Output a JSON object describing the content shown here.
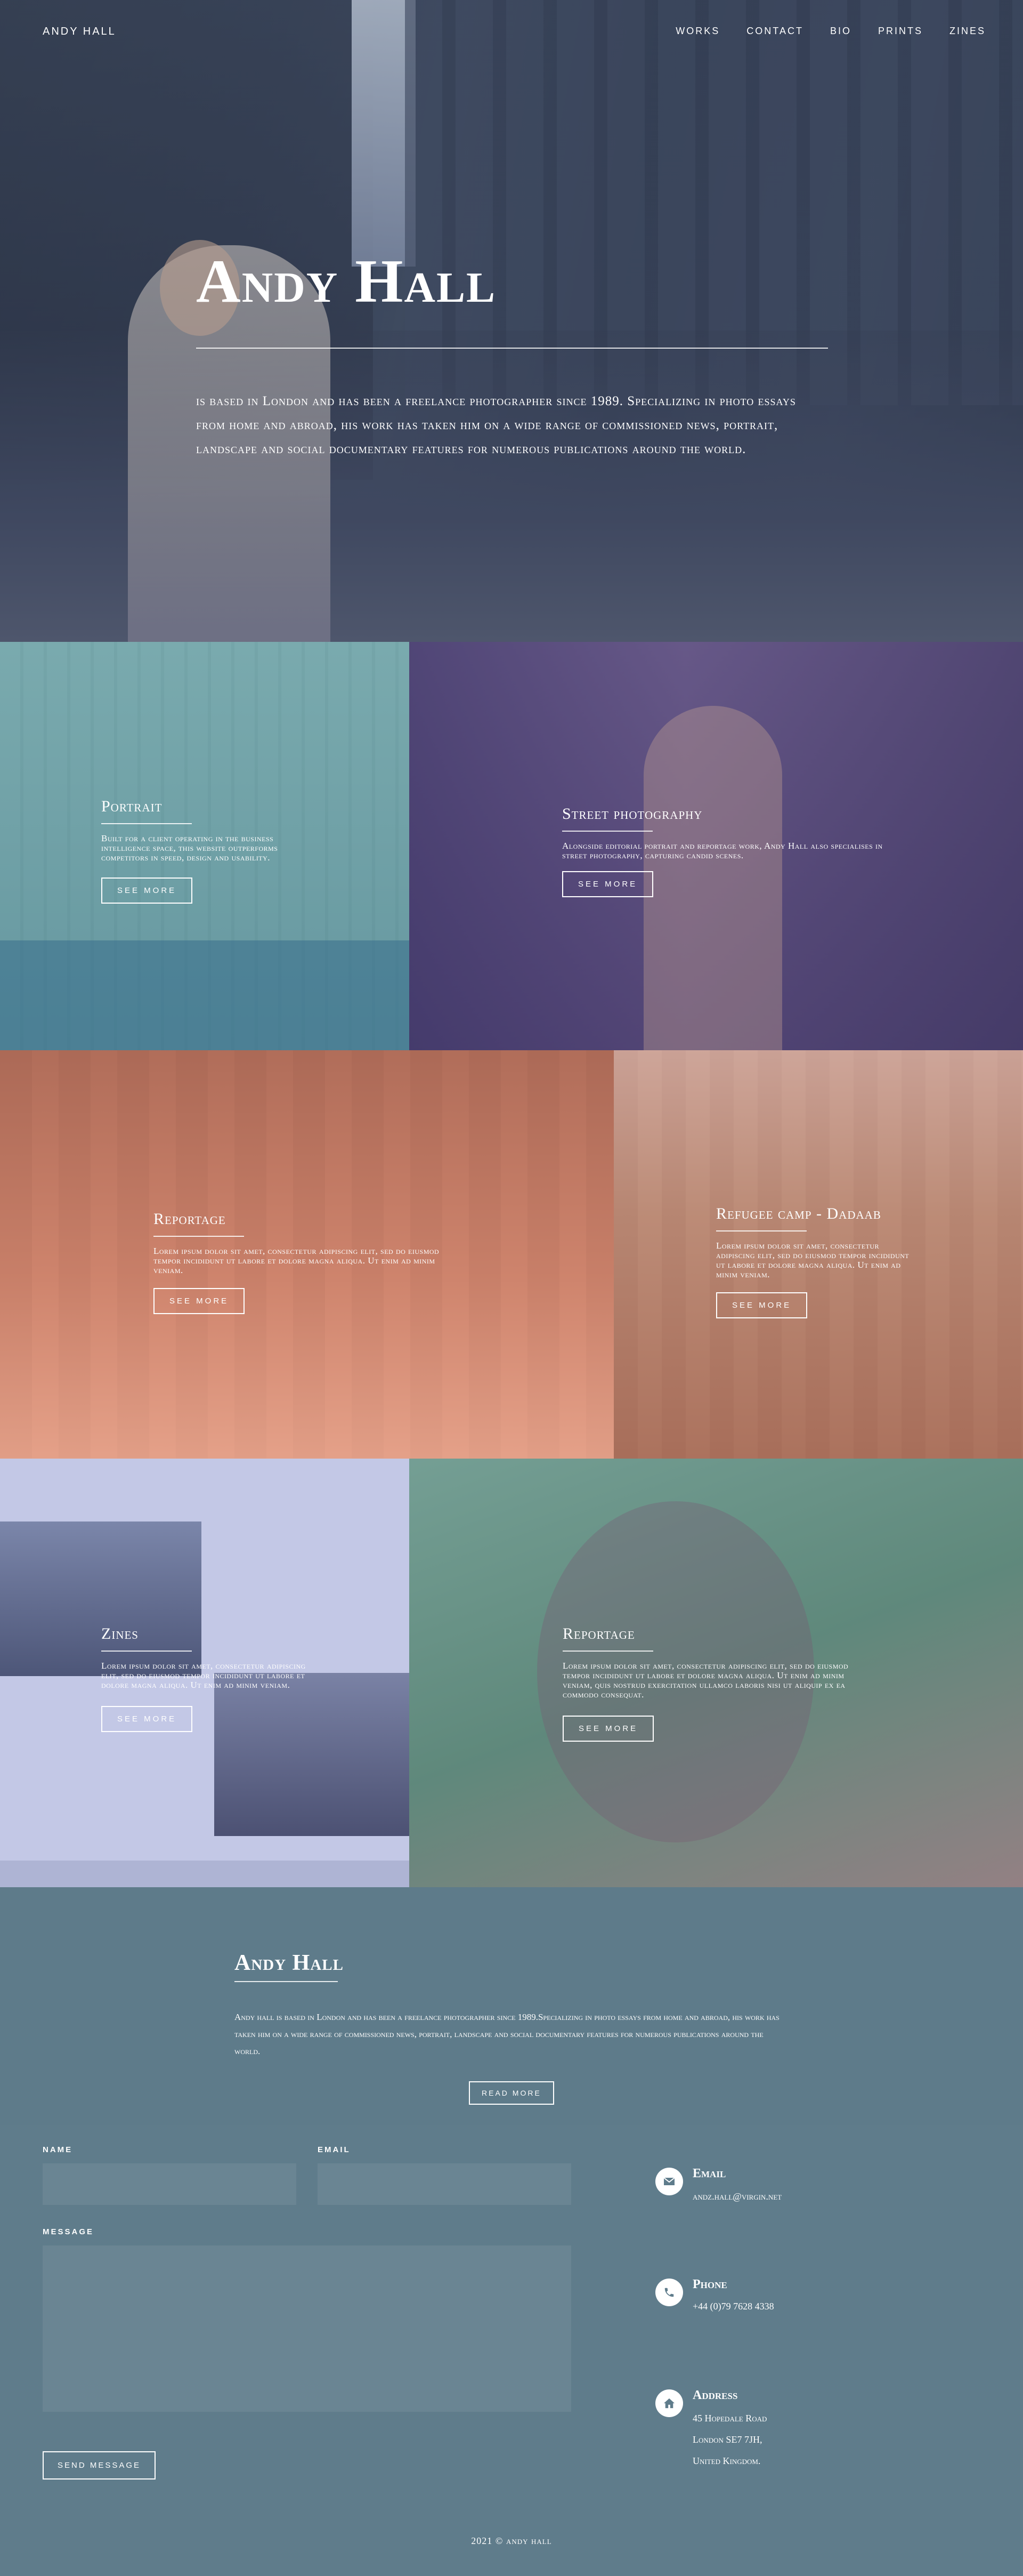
{
  "nav": {
    "brand": "ANDY HALL",
    "items": [
      "WORKS",
      "CONTACT",
      "BIO",
      "PRINTS",
      "ZINES"
    ]
  },
  "hero": {
    "title": "Andy Hall",
    "text": "is based in London and has been a freelance photographer since 1989. Specializing in photo essays from home and abroad, his work has taken him on a wide range of commissioned news, portrait, landscape and social documentary features for numerous publications around the world."
  },
  "tiles": [
    {
      "title": "Portrait",
      "text": "Built for a client operating in the business intelligence space, this website outperforms competitors in speed, design and usability.",
      "button": "SEE MORE",
      "color": "#6ea7ad"
    },
    {
      "title": "Street photography",
      "text": "Alongside editorial portrait and reportage work, Andy Hall also specialises in street photography, capturing candid scenes.",
      "button": "SEE MORE",
      "color": "#4b3f6e"
    },
    {
      "title": "Reportage",
      "text": "Lorem ipsum dolor sit amet, consectetur adipiscing elit, sed do eiusmod tempor incididunt ut labore et dolore magna aliqua. Ut enim ad minim veniam.",
      "button": "SEE MORE",
      "color": "#e59a86"
    },
    {
      "title": "Refugee camp - Dadaab",
      "text": "Lorem ipsum dolor sit amet, consectetur adipiscing elit, sed do eiusmod tempor incididunt ut labore et dolore magna aliqua. Ut enim ad minim veniam.",
      "button": "SEE MORE",
      "color": "#c99986"
    },
    {
      "title": "Zines",
      "text": "Lorem ipsum dolor sit amet, consectetur adipiscing elit, sed do eiusmod tempor incididunt ut labore et dolore magna aliqua. Ut enim ad minim veniam.",
      "button": "SEE MORE",
      "color": "#b8bfe0"
    },
    {
      "title": "Reportage",
      "text": "Lorem ipsum dolor sit amet, consectetur adipiscing elit, sed do eiusmod tempor incididunt ut labore et dolore magna aliqua. Ut enim ad minim veniam, quis nostrud exercitation ullamco laboris nisi ut aliquip ex ea commodo consequat.",
      "button": "SEE MORE",
      "color": "#6e9a8a"
    }
  ],
  "about": {
    "title": "Andy Hall",
    "text": "Andy hall is based in London and has been a freelance photographer since 1989.Specializing in photo essays from home and abroad, his work has taken him on a wide range of commissioned news, portrait, landscape and social documentary features for numerous publications around the world.",
    "button": "READ MORE"
  },
  "contact": {
    "name_label": "NAME",
    "email_label": "EMAIL",
    "message_label": "MESSAGE",
    "send_label": "SEND MESSAGE",
    "email_title": "Email",
    "email_value": "andz.hall@virgin.net",
    "phone_title": "Phone",
    "phone_value": "+44 (0)79 7628 4338",
    "address_title": "Address",
    "address_lines": [
      "45 Hopedale Road",
      "London SE7 7JH,",
      "United Kingdom."
    ]
  },
  "footer": {
    "copyright": "2021 © andy hall"
  },
  "colors": {
    "footer_bg": "#5f7c8b",
    "field_bg": "#6a8593"
  }
}
